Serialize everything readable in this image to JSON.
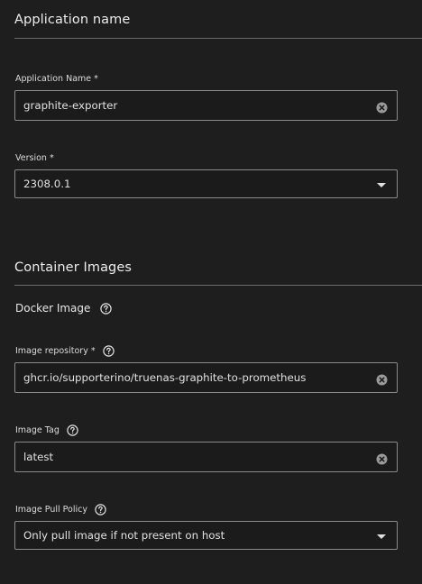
{
  "sections": {
    "application": {
      "title": "Application name",
      "app_name_field": {
        "label": "Application Name",
        "required_mark": "*",
        "value": "graphite-exporter"
      },
      "version_field": {
        "label": "Version",
        "required_mark": "*",
        "value": "2308.0.1"
      }
    },
    "container": {
      "title": "Container Images",
      "docker_image_heading": "Docker Image",
      "image_repository_field": {
        "label": "Image repository",
        "required_mark": "*",
        "value": "ghcr.io/supporterino/truenas-graphite-to-prometheus"
      },
      "image_tag_field": {
        "label": "Image Tag",
        "value": "latest"
      },
      "pull_policy_field": {
        "label": "Image Pull Policy",
        "value": "Only pull image if not present on host"
      }
    }
  },
  "icons": {
    "help": "help-circle-icon",
    "clear": "clear-circle-icon",
    "dropdown": "chevron-down-icon"
  },
  "colors": {
    "background": "#1e1e1e",
    "input_border": "#8a8a8a",
    "rule": "#6a6a6a",
    "text": "#e6e6e6"
  }
}
